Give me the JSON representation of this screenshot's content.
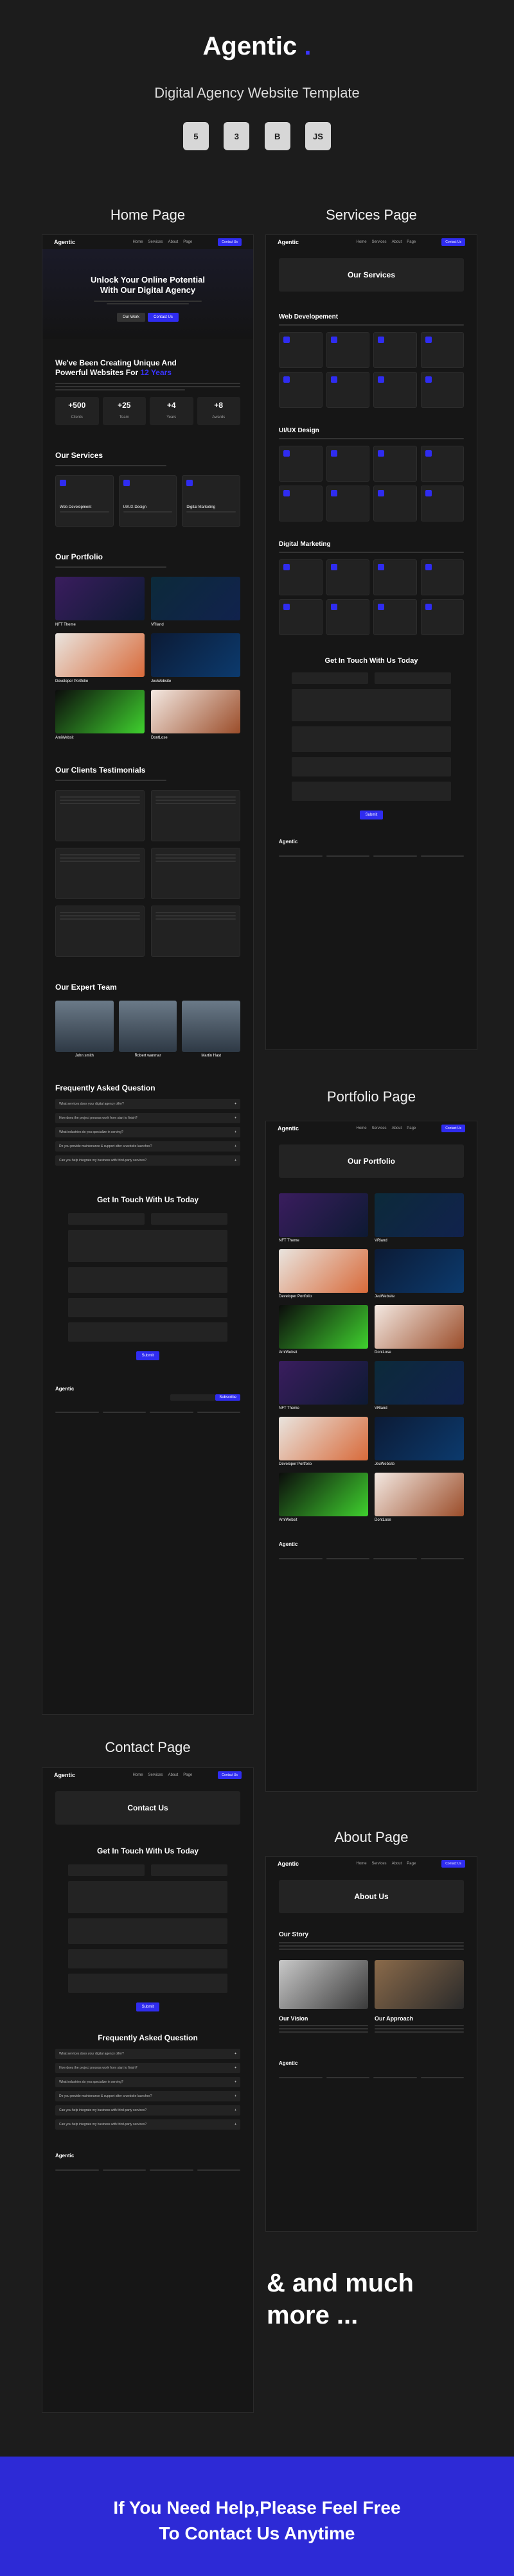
{
  "header": {
    "title": "Agentic",
    "dot": ".",
    "subtitle": "Digital Agency Website Template",
    "tech_badges": [
      "5",
      "3",
      "B",
      "JS"
    ]
  },
  "sections": {
    "home": "Home Page",
    "services": "Services Page",
    "portfolio": "Portfolio Page",
    "contact": "Contact Page",
    "about": "About Page"
  },
  "nav": {
    "logo": "Agentic",
    "links": [
      "Home",
      "Services",
      "About",
      "Page"
    ],
    "cta": "Contact Us"
  },
  "home": {
    "hero_title": "Unlock Your Online Potential With Our Digital Agency",
    "hero_btn1": "Our Work",
    "hero_btn2": "Contact Us",
    "creating_title_1": "We've Been Creating Unique And",
    "creating_title_2": "Powerful Websites For",
    "creating_title_accent": "12 Years",
    "stats": [
      {
        "value": "+500",
        "label": "Clients"
      },
      {
        "value": "+25",
        "label": "Team"
      },
      {
        "value": "+4",
        "label": "Years"
      },
      {
        "value": "+8",
        "label": "Awards"
      }
    ],
    "services_title": "Our Services",
    "services": [
      "Web Development",
      "UI/UX Design",
      "Digital Marketing"
    ],
    "portfolio_title": "Our Portfolio",
    "portfolio_items": [
      "NFT Theme",
      "VRland",
      "Developer Portfolio",
      "JeuWebsite",
      "AmiWebsit",
      "DontLose"
    ],
    "testimonials_title": "Our Clients Testimonials",
    "team_title": "Our Expert Team",
    "team": [
      "John smith",
      "Robert wanmar",
      "Martin Hast"
    ],
    "faq_title": "Frequently Asked Question",
    "faqs": [
      "What services does your digital agency offer?",
      "How does the project process work from start to finish?",
      "What industries do you specialize in serving?",
      "Do you provide maintenance & support after a website launches?",
      "Can you help integrate my business with third-party services?"
    ],
    "contact_title": "Get In Touch With Us Today",
    "submit": "Submit"
  },
  "services_page": {
    "title": "Our Services",
    "web_dev": "Web Developement",
    "uiux": "UI/UX Design",
    "digital": "Digital Marketing",
    "contact_title": "Get In Touch With Us Today"
  },
  "portfolio_page": {
    "title": "Our Portfolio",
    "items": [
      "NFT Theme",
      "VRland",
      "Developer Portfolio",
      "JeuWebsite",
      "AmiWebsit",
      "DontLose",
      "NFT Theme",
      "VRland",
      "Developer Portfolio",
      "JeuWebsite",
      "AmiWebsit",
      "DontLose"
    ]
  },
  "contact_page": {
    "title": "Contact Us",
    "touch": "Get In Touch With Us Today",
    "faq_title": "Frequently Asked Question"
  },
  "about_page": {
    "title": "About Us",
    "story": "Our Story",
    "vision": "Our Vision",
    "approach": "Our Approach"
  },
  "footer": {
    "logo": "Agentic",
    "subscribe": "Subscribe"
  },
  "more": "& and much more ...",
  "banner": {
    "line1": "If You Need Help,Please Feel Free",
    "line2": "To Contact Us Anytime"
  }
}
